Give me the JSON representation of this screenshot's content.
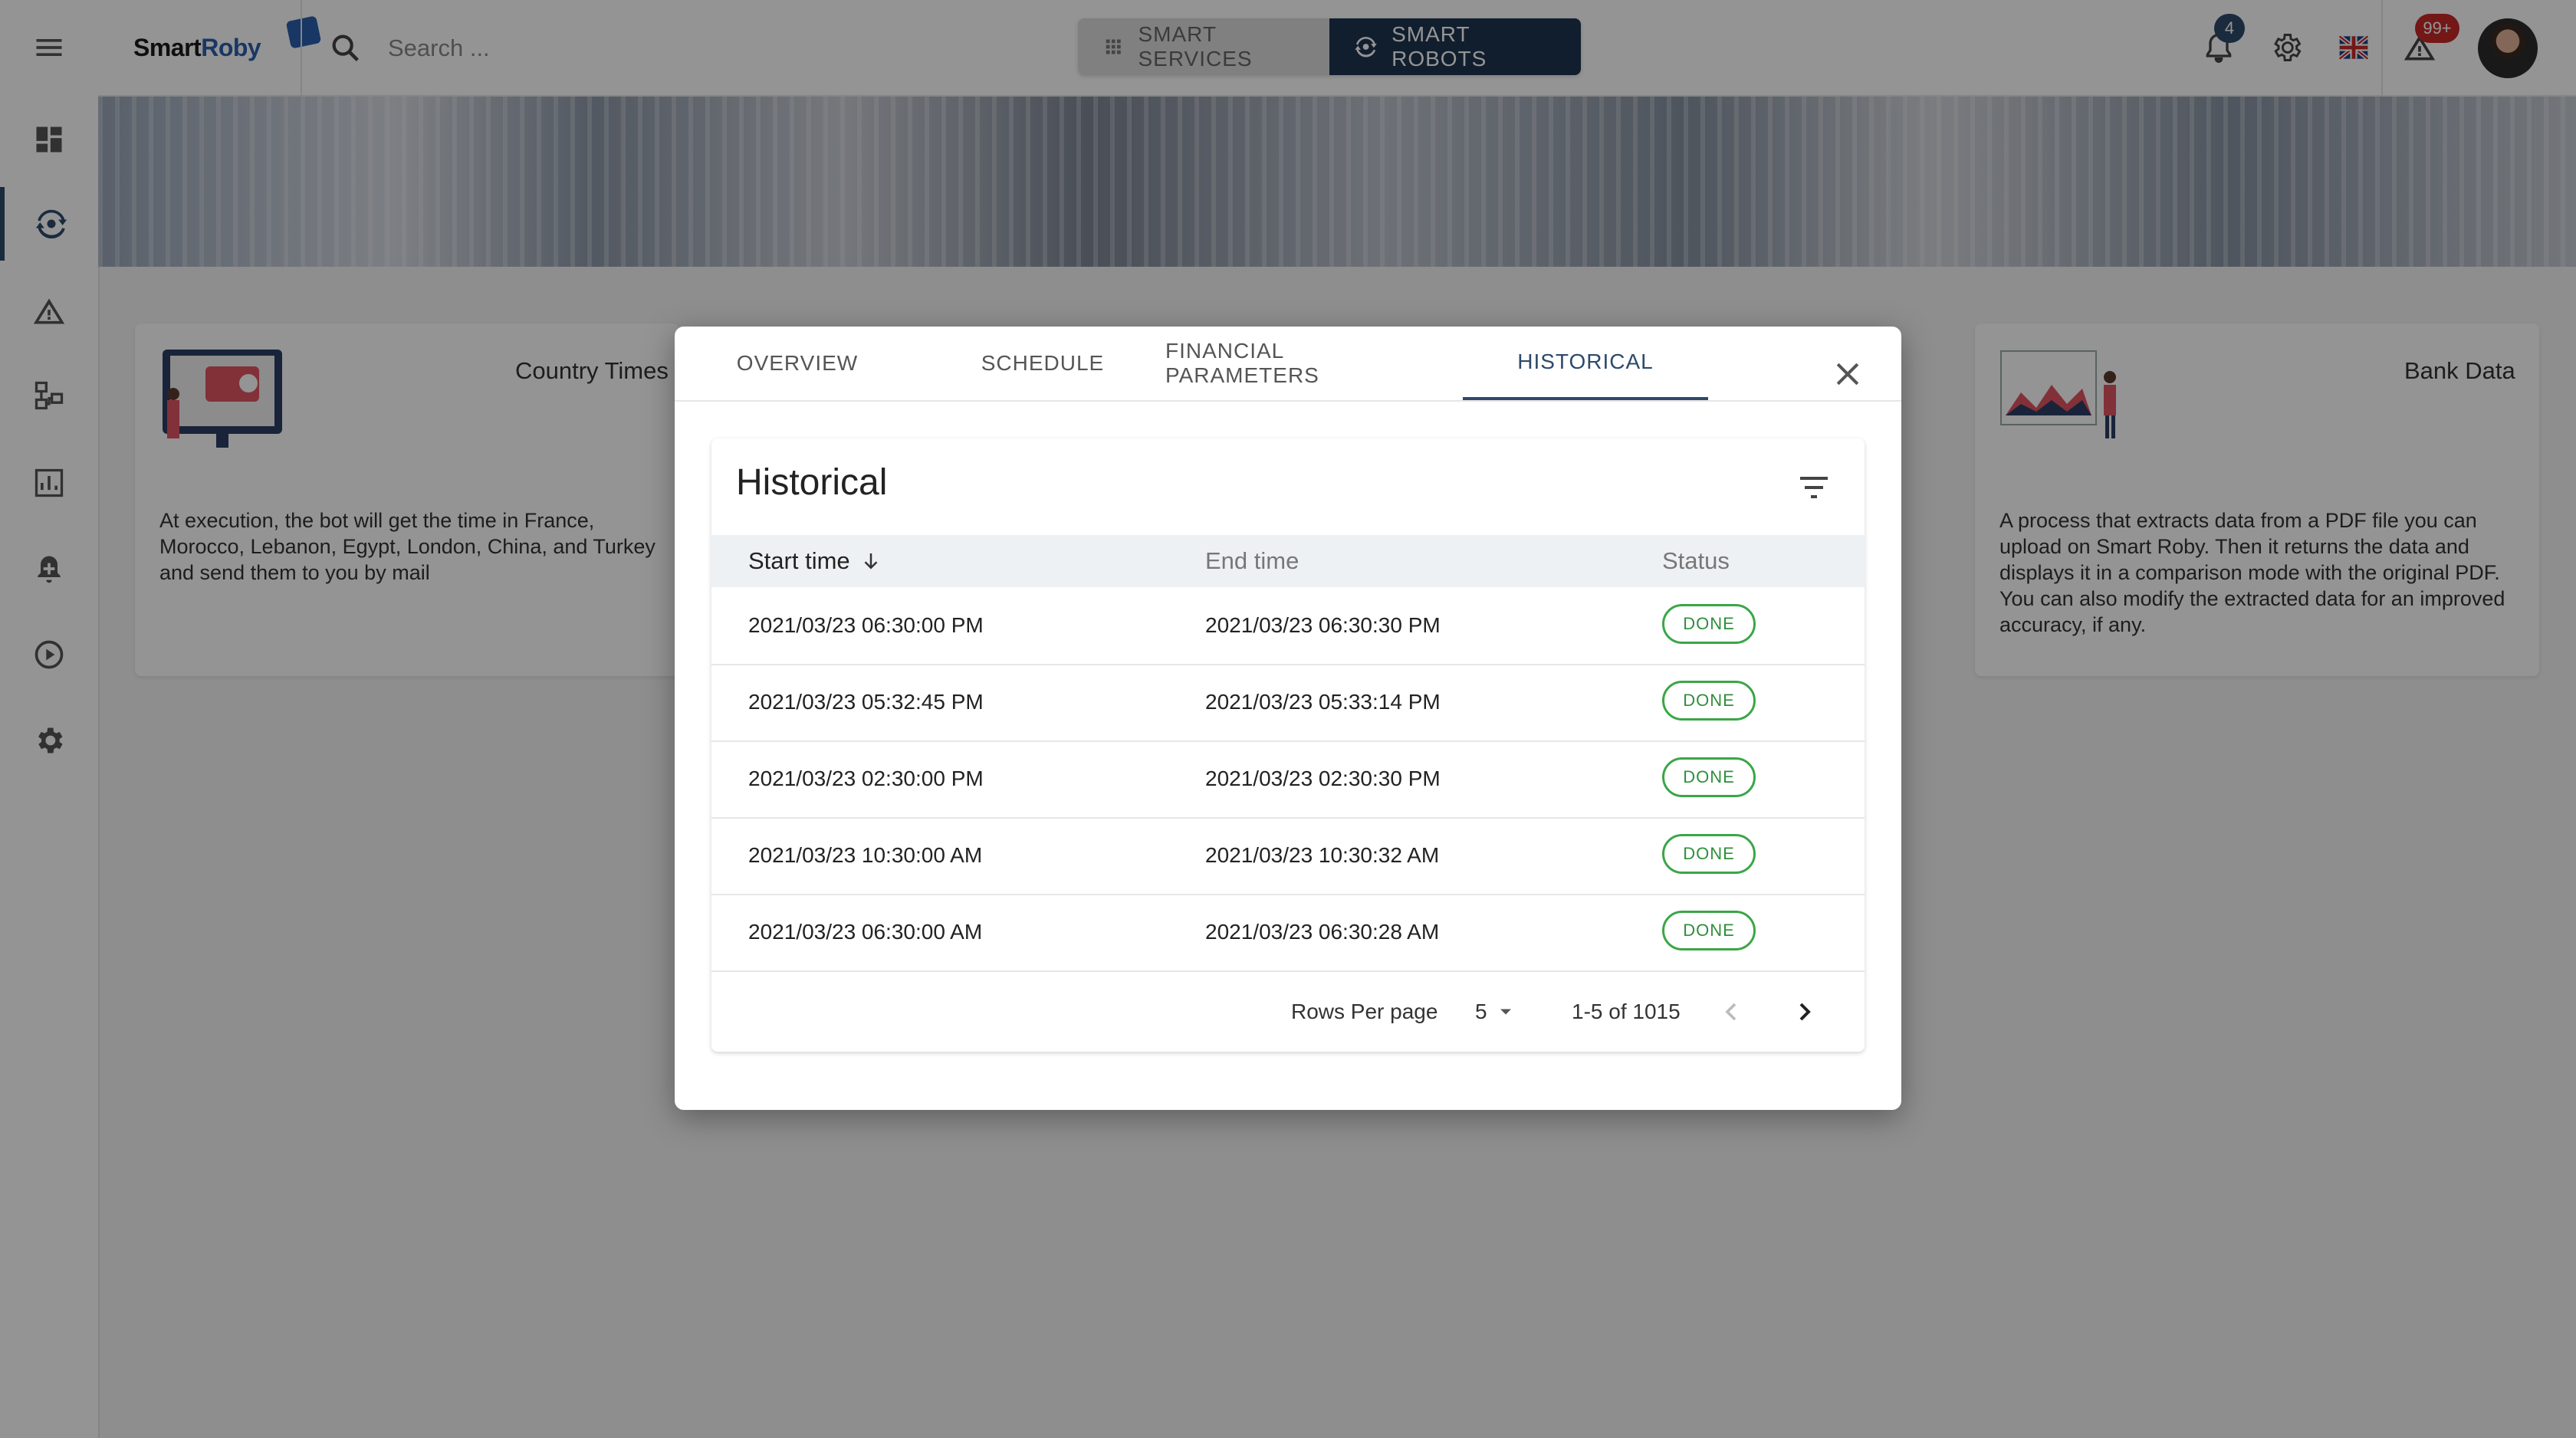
{
  "app": {
    "logo_part1": "Smart",
    "logo_part2": "Roby"
  },
  "search": {
    "placeholder": "Search ..."
  },
  "nav_toggle": {
    "services": "SMART SERVICES",
    "robots": "SMART ROBOTS"
  },
  "topbar": {
    "notifications_count": "4",
    "alerts_count": "99+"
  },
  "colors": {
    "primary": "#1e3550",
    "accent": "#2d4a6b",
    "done": "#3aa647",
    "badge": "#c62828"
  },
  "sidebar": {
    "items": [
      {
        "icon": "menu-icon"
      },
      {
        "icon": "dashboard-icon"
      },
      {
        "icon": "robot-sync-icon"
      },
      {
        "icon": "warning-icon"
      },
      {
        "icon": "workflow-icon"
      },
      {
        "icon": "report-icon"
      },
      {
        "icon": "alarm-icon"
      },
      {
        "icon": "play-circle-icon"
      },
      {
        "icon": "settings-icon"
      }
    ]
  },
  "cards": [
    {
      "title": "Country Times",
      "description": "At execution, the bot will get the time in France, Morocco, Lebanon, Egypt, London, China, and Turkey and send them to you by mail"
    },
    {
      "title": "Bank Data",
      "description": "A process that extracts data from a PDF file you can upload on Smart Roby. Then it returns the data and displays it in a comparison mode with the original PDF. You can also modify the extracted data for an improved accuracy, if any."
    }
  ],
  "modal": {
    "tabs": [
      "OVERVIEW",
      "SCHEDULE",
      "FINANCIAL PARAMETERS",
      "HISTORICAL"
    ],
    "active_tab": "HISTORICAL",
    "section_title": "Historical",
    "columns": [
      "Start time",
      "End time",
      "Status"
    ],
    "rows": [
      {
        "start": "2021/03/23 06:30:00 PM",
        "end": "2021/03/23 06:30:30 PM",
        "status": "DONE"
      },
      {
        "start": "2021/03/23 05:32:45 PM",
        "end": "2021/03/23 05:33:14 PM",
        "status": "DONE"
      },
      {
        "start": "2021/03/23 02:30:00 PM",
        "end": "2021/03/23 02:30:30 PM",
        "status": "DONE"
      },
      {
        "start": "2021/03/23 10:30:00 AM",
        "end": "2021/03/23 10:30:32 AM",
        "status": "DONE"
      },
      {
        "start": "2021/03/23 06:30:00 AM",
        "end": "2021/03/23 06:30:28 AM",
        "status": "DONE"
      }
    ],
    "pagination": {
      "rows_per_page_label": "Rows Per page",
      "rows_per_page": "5",
      "range": "1-5 of 1015"
    }
  }
}
